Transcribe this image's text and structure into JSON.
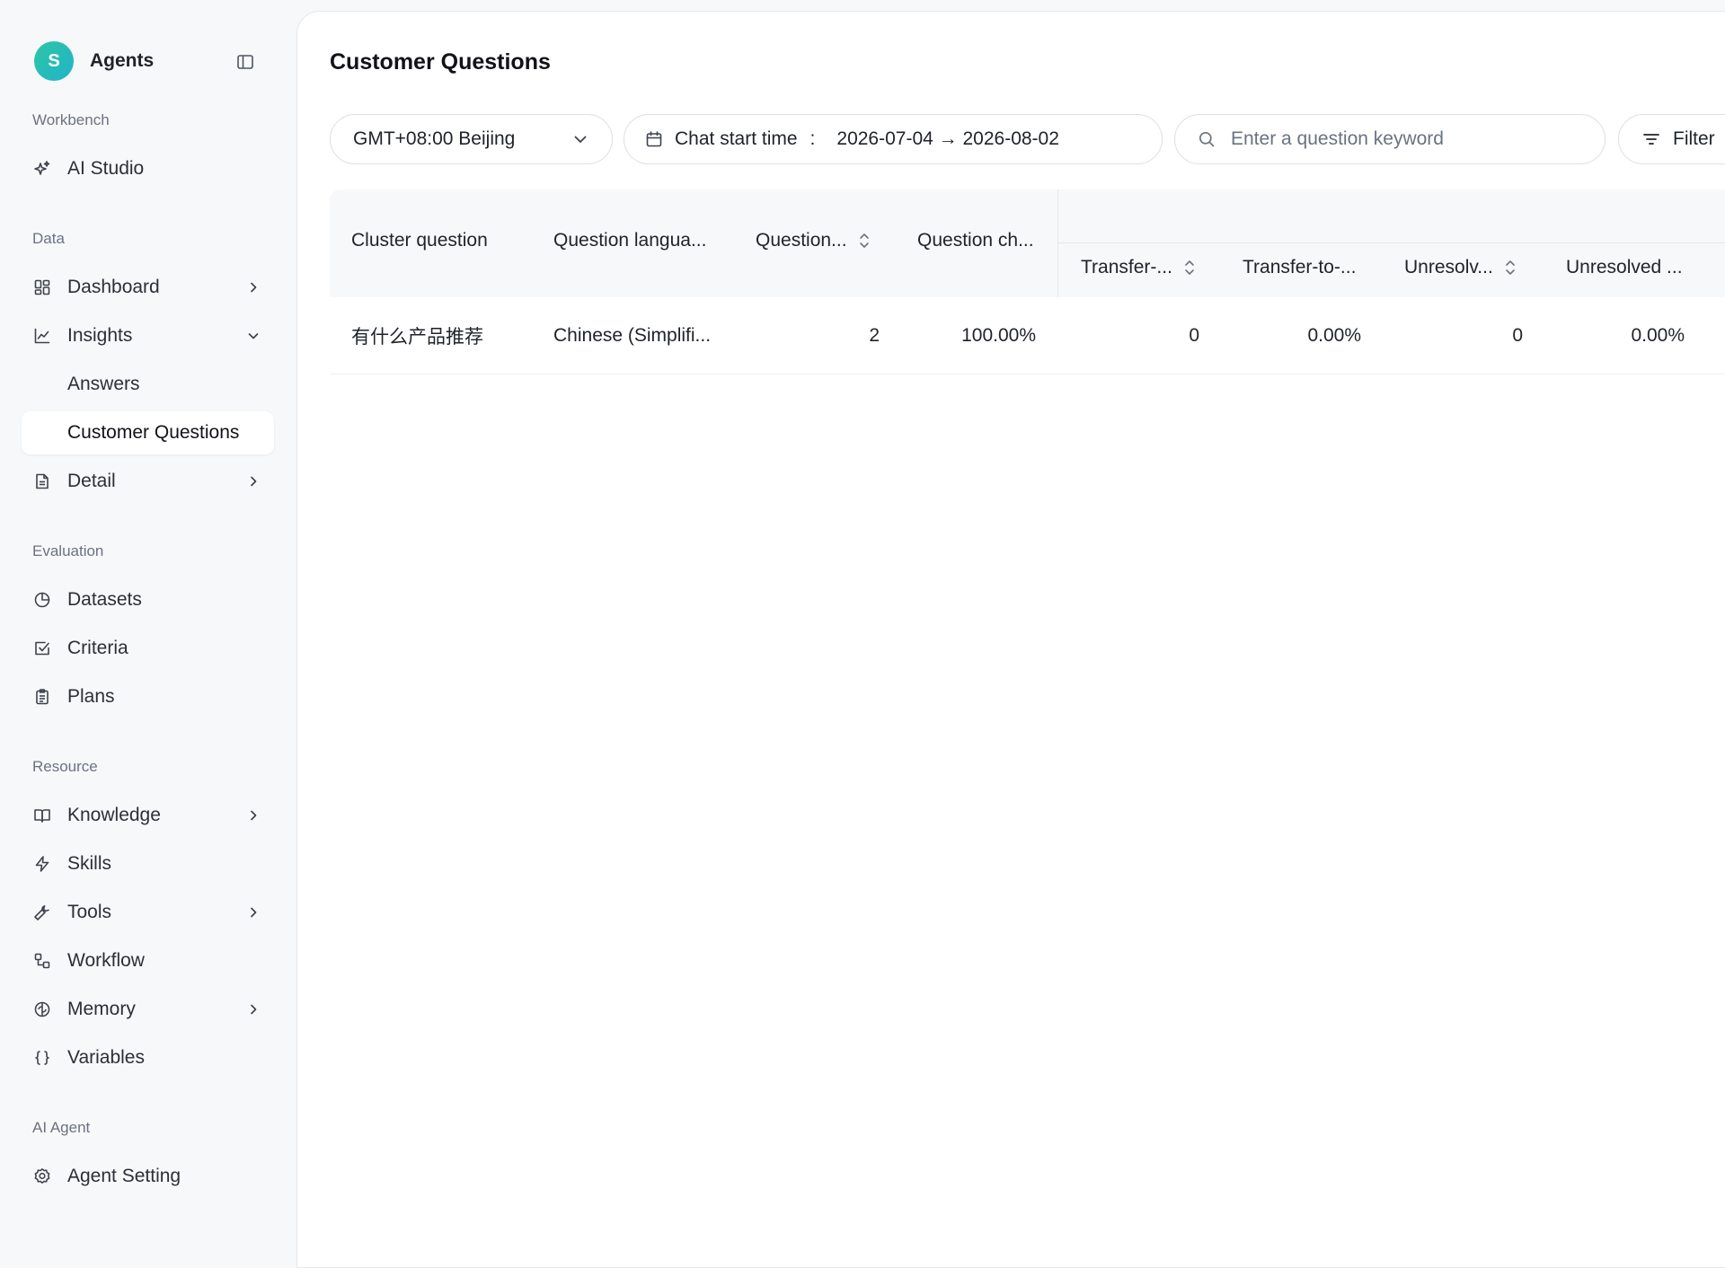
{
  "brand": {
    "initial": "S",
    "name": "Agents"
  },
  "sidebar": {
    "sections": [
      {
        "title": "Workbench"
      },
      {
        "title": "Data"
      },
      {
        "title": "Evaluation"
      },
      {
        "title": "Resource"
      },
      {
        "title": "AI Agent"
      }
    ],
    "items": {
      "ai_studio": "AI Studio",
      "dashboard": "Dashboard",
      "insights": "Insights",
      "answers": "Answers",
      "customer_questions": "Customer Questions",
      "detail": "Detail",
      "datasets": "Datasets",
      "criteria": "Criteria",
      "plans": "Plans",
      "knowledge": "Knowledge",
      "skills": "Skills",
      "tools": "Tools",
      "workflow": "Workflow",
      "memory": "Memory",
      "variables": "Variables",
      "agent_setting": "Agent Setting"
    },
    "active": "customer_questions"
  },
  "page": {
    "title": "Customer Questions"
  },
  "filters": {
    "timezone": "GMT+08:00 Beijing",
    "date_label": "Chat start time",
    "date_colon": ":",
    "date_range": "2026-07-04 → 2026-08-02",
    "search_placeholder": "Enter a question keyword",
    "search_value": "",
    "filter_label": "Filter"
  },
  "table": {
    "columns": [
      "Cluster question",
      "Question langua...",
      "Question...",
      "Question ch...",
      "Transfer-...",
      "Transfer-to-...",
      "Unresolv...",
      "Unresolved ..."
    ],
    "rows": [
      [
        "有什么产品推荐",
        "Chinese (Simplifi...",
        "2",
        "100.00%",
        "0",
        "0.00%",
        "0",
        "0.00%"
      ]
    ]
  },
  "colors": {
    "accent": "#22b3c9",
    "avatar_start": "#2cc6a5"
  }
}
